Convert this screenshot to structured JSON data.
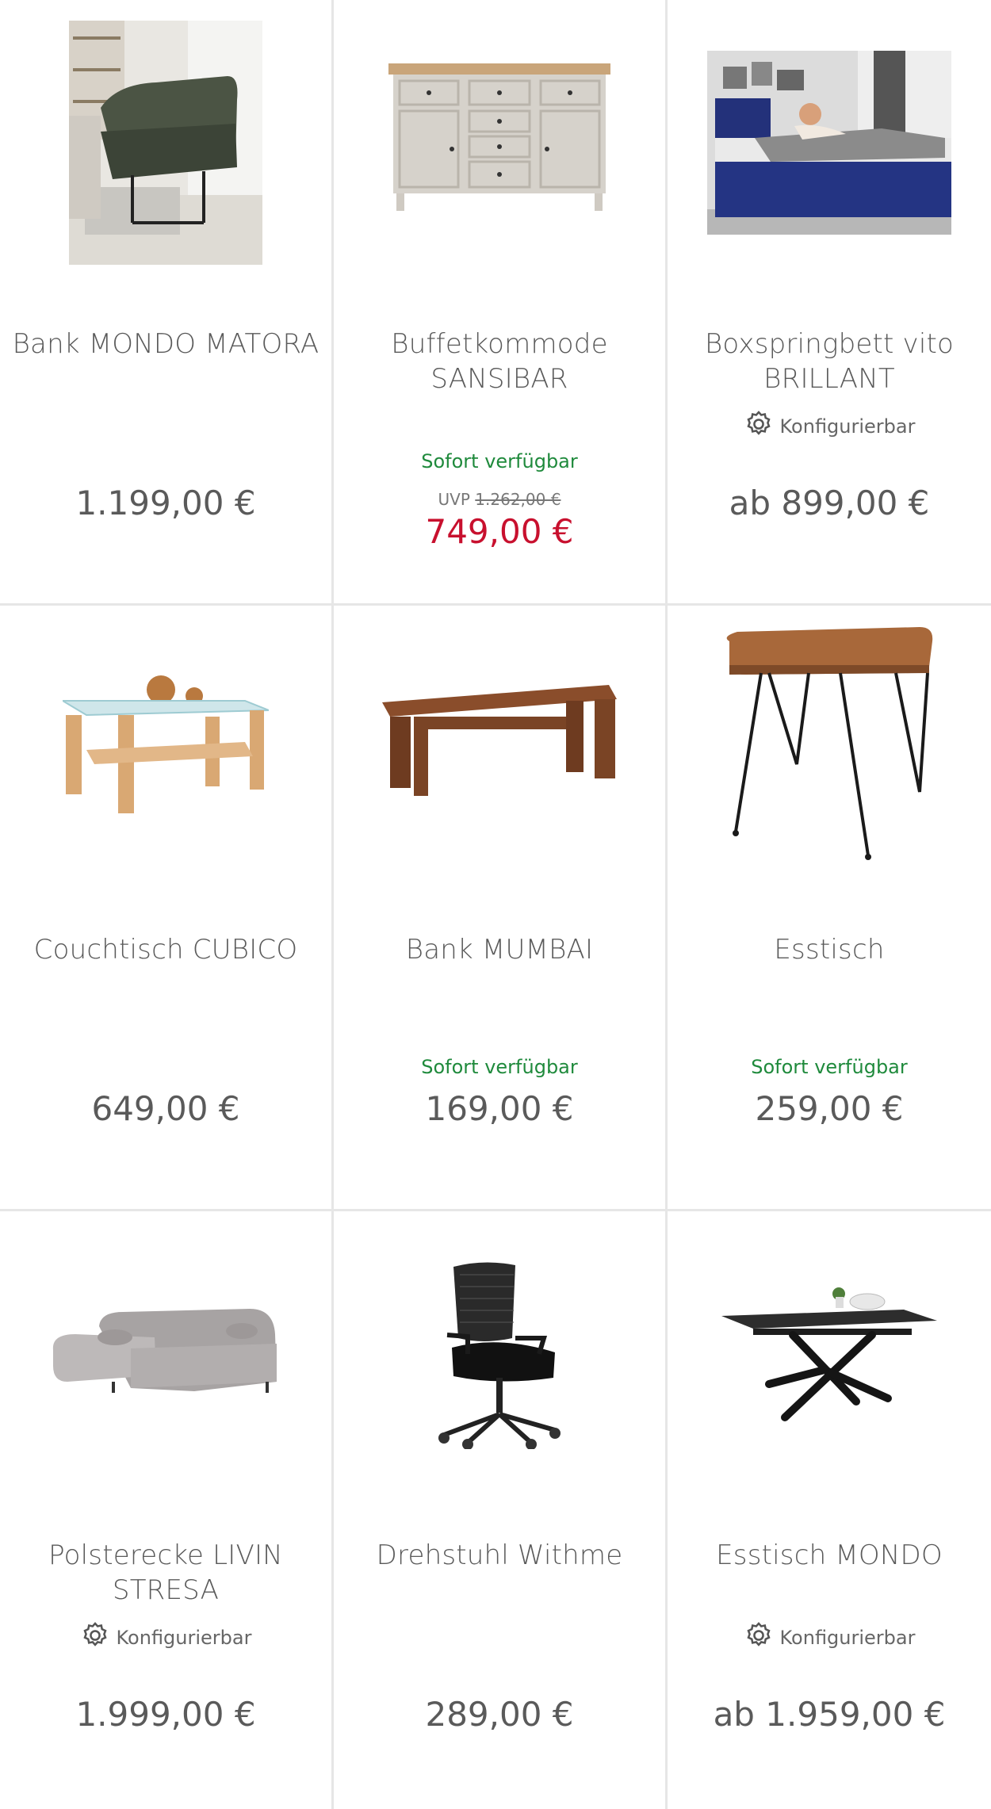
{
  "colors": {
    "available": "#1f8a3c",
    "sale": "#c8102e",
    "text": "#5a5a5a",
    "divider": "#e6e6e6"
  },
  "products": [
    {
      "title": "Bank MONDO MATORA",
      "price": "1.199,00 €",
      "image": "green-sofa-bench-photo"
    },
    {
      "title": "Buffetkommode SANSIBAR",
      "availability": "Sofort verfügbar",
      "uvp_label": "UVP",
      "uvp_price": "1.262,00 €",
      "price": "749,00 €",
      "image": "sideboard-photo"
    },
    {
      "title": "Boxspringbett vito BRILLANT",
      "configurable": "Konfigurierbar",
      "price": "ab 899,00 €",
      "image": "blue-boxspring-bed-photo"
    },
    {
      "title": "Couchtisch CUBICO",
      "price": "649,00 €",
      "image": "glass-coffee-table-photo"
    },
    {
      "title": "Bank MUMBAI",
      "availability": "Sofort verfügbar",
      "price": "169,00 €",
      "image": "wooden-bench-photo"
    },
    {
      "title": "Esstisch",
      "availability": "Sofort verfügbar",
      "price": "259,00 €",
      "image": "hairpin-table-photo"
    },
    {
      "title": "Polsterecke LIVIN STRESA",
      "configurable": "Konfigurierbar",
      "price": "1.999,00 €",
      "image": "corner-sofa-photo"
    },
    {
      "title": "Drehstuhl Withme",
      "price": "289,00 €",
      "image": "office-chair-photo"
    },
    {
      "title": "Esstisch MONDO",
      "configurable": "Konfigurierbar",
      "price": "ab 1.959,00 €",
      "image": "extendable-dining-table-photo"
    }
  ]
}
